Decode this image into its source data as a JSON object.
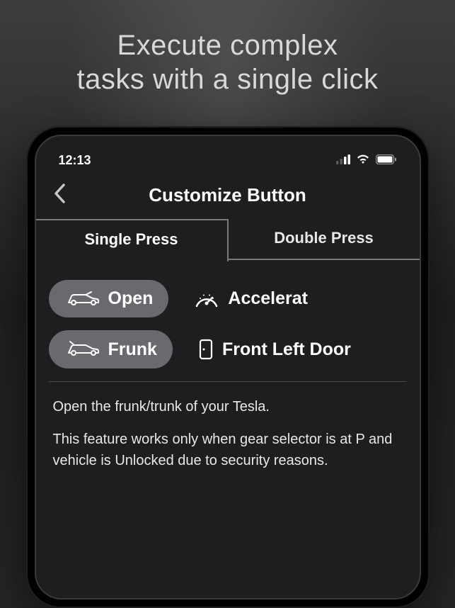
{
  "promo": {
    "line1": "Execute complex",
    "line2": "tasks with a single click"
  },
  "statusBar": {
    "time": "12:13"
  },
  "header": {
    "title": "Customize Button"
  },
  "tabs": {
    "single": "Single Press",
    "double": "Double Press"
  },
  "actions": {
    "row1": {
      "open": "Open",
      "accelerate": "Accelerat"
    },
    "row2": {
      "frunk": "Frunk",
      "frontLeftDoor": "Front Left Door"
    }
  },
  "description": {
    "p1": "Open the frunk/trunk of your Tesla.",
    "p2": " This feature works only when gear selector is at P and vehicle is Unlocked due to security reasons."
  }
}
